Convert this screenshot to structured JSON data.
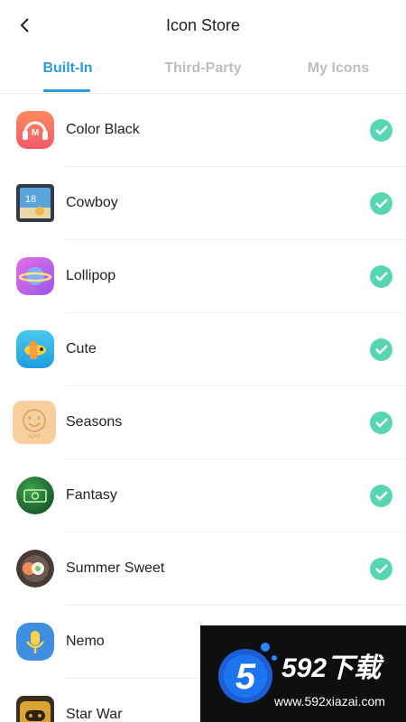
{
  "header": {
    "title": "Icon Store",
    "back_icon": "chevron-left-icon"
  },
  "tabs": [
    {
      "label": "Built-In",
      "active": true
    },
    {
      "label": "Third-Party",
      "active": false
    },
    {
      "label": "My Icons",
      "active": false
    }
  ],
  "colors": {
    "accent": "#2b9bd9",
    "check": "#56d6b3",
    "inactive_tab": "#bdbdbd"
  },
  "icon_packs": [
    {
      "name": "Color Black",
      "icon": "headphones-m-icon",
      "installed": true
    },
    {
      "name": "Cowboy",
      "icon": "calendar-18-icon",
      "installed": true
    },
    {
      "name": "Lollipop",
      "icon": "planet-icon",
      "installed": true
    },
    {
      "name": "Cute",
      "icon": "airplane-icon",
      "installed": true
    },
    {
      "name": "Seasons",
      "icon": "smiley-app-icon",
      "installed": true
    },
    {
      "name": "Fantasy",
      "icon": "money-icon",
      "installed": true
    },
    {
      "name": "Summer Sweet",
      "icon": "sushi-icon",
      "installed": true
    },
    {
      "name": "Nemo",
      "icon": "microphone-icon",
      "installed": false
    },
    {
      "name": "Star War",
      "icon": "gamepad-icon",
      "installed": false
    }
  ],
  "watermark": {
    "name": "592下载",
    "url": "www.592xiazai.com",
    "logo_digit": "5"
  }
}
